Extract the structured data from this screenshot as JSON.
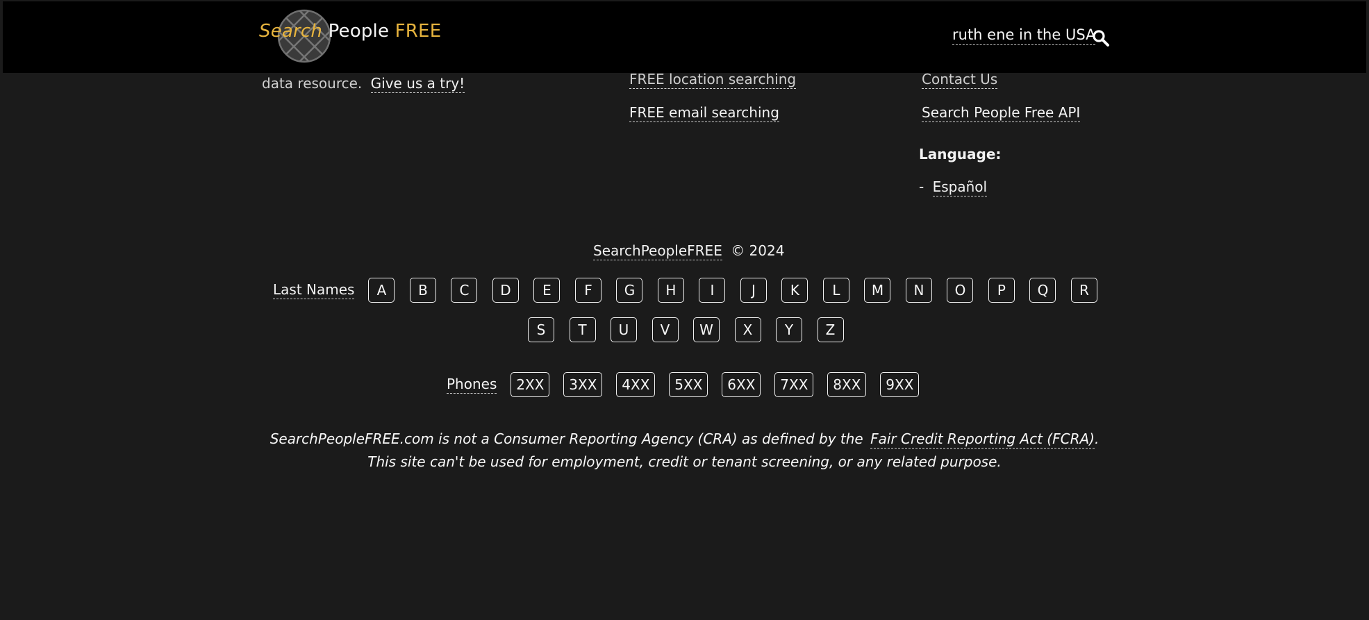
{
  "header": {
    "logo": {
      "word1": "Search",
      "word2": "People",
      "word3": "FREE"
    },
    "search_text": "ruth ene in the USA"
  },
  "footer": {
    "about": {
      "text": "data resource.",
      "link": "Give us a try!"
    },
    "services": [
      "FREE location searching",
      "FREE email searching"
    ],
    "company": [
      "Contact Us",
      "Search People Free API"
    ],
    "language": {
      "label": "Language:",
      "bullet": "-",
      "option": "Español"
    },
    "copyright": {
      "brand": "SearchPeopleFREE",
      "year_text": "© 2024"
    },
    "last_names": {
      "label": "Last Names",
      "letters": [
        "A",
        "B",
        "C",
        "D",
        "E",
        "F",
        "G",
        "H",
        "I",
        "J",
        "K",
        "L",
        "M",
        "N",
        "O",
        "P",
        "Q",
        "R",
        "S",
        "T",
        "U",
        "V",
        "W",
        "X",
        "Y",
        "Z"
      ]
    },
    "phones": {
      "label": "Phones",
      "prefixes": [
        "2XX",
        "3XX",
        "4XX",
        "5XX",
        "6XX",
        "7XX",
        "8XX",
        "9XX"
      ]
    },
    "disclaimer": {
      "line1_prefix": "SearchPeopleFREE.com is not a Consumer Reporting Agency (CRA) as defined by the",
      "line1_link": "Fair Credit Reporting Act (FCRA)",
      "line1_suffix": ".",
      "line2": "This site can't be used for employment, credit or tenant screening, or any related purpose."
    }
  },
  "colors": {
    "accent": "#e7b43e",
    "header_bg": "#000000",
    "page_bg": "#1b1b1b"
  },
  "icons": {
    "search": "search-icon",
    "logo": "globe-grid-icon"
  }
}
